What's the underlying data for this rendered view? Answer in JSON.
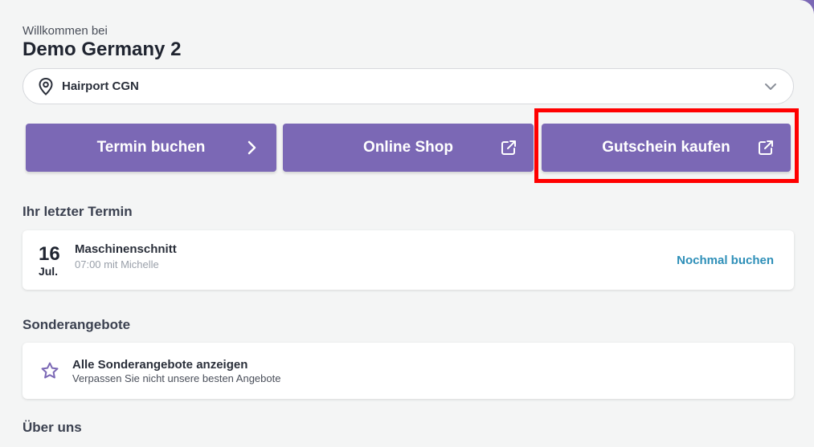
{
  "header": {
    "welcome": "Willkommen bei",
    "company": "Demo Germany 2"
  },
  "location": {
    "selected": "Hairport CGN",
    "icon": "location-pin-icon"
  },
  "actions": {
    "termin": {
      "label": "Termin buchen",
      "icon": "chevron-right-icon"
    },
    "shop": {
      "label": "Online Shop",
      "icon": "external-link-icon"
    },
    "gutschein": {
      "label": "Gutschein kaufen",
      "icon": "external-link-icon"
    }
  },
  "last_appointment": {
    "title": "Ihr letzter Termin",
    "day": "16",
    "month": "Jul.",
    "service": "Maschinenschnitt",
    "detail": "07:00 mit Michelle",
    "rebook": "Nochmal buchen"
  },
  "offers": {
    "title": "Sonderangebote",
    "item_title": "Alle Sonderangebote anzeigen",
    "item_sub": "Verpassen Sie nicht unsere besten Angebote",
    "icon": "star-icon"
  },
  "about": {
    "title": "Über uns"
  },
  "colors": {
    "primary": "#7b68b5",
    "link": "#2e8fb8",
    "highlight": "#ff0000",
    "background": "#f4f5f5"
  }
}
